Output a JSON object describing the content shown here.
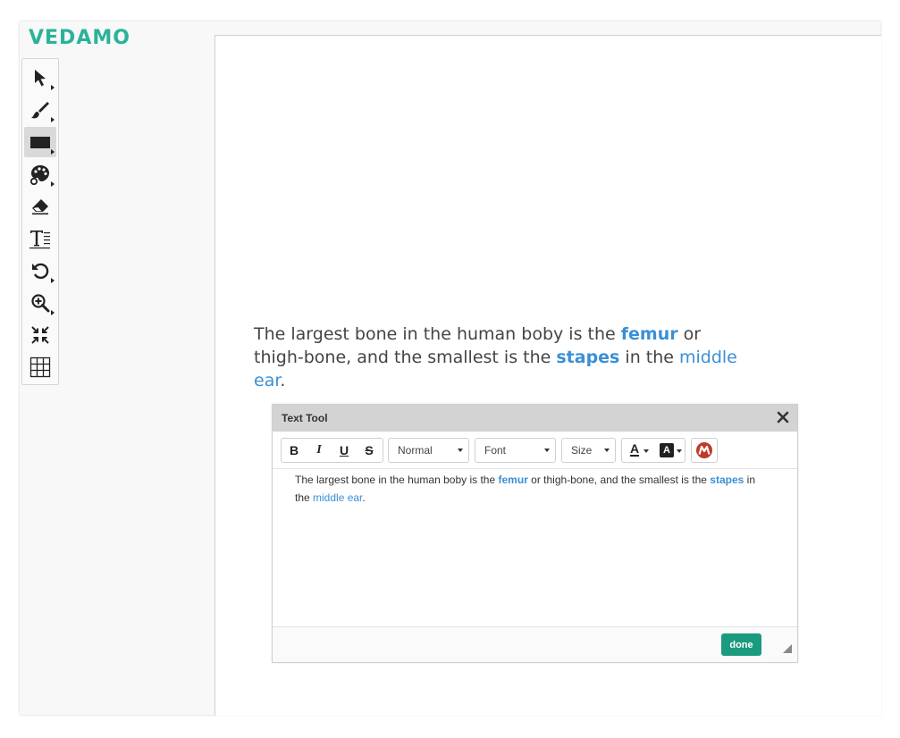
{
  "brand": {
    "logo_text": "VEDAMO",
    "accent": "#2bb29a"
  },
  "toolbar": {
    "tools": [
      {
        "name": "select-tool",
        "icon": "cursor-arrow-icon",
        "has_menu": true
      },
      {
        "name": "brush-tool",
        "icon": "paintbrush-icon",
        "has_menu": true
      },
      {
        "name": "shape-tool",
        "icon": "rectangle-icon",
        "has_menu": true,
        "active": true
      },
      {
        "name": "color-tool",
        "icon": "palette-icon",
        "has_menu": true
      },
      {
        "name": "eraser-tool",
        "icon": "eraser-icon",
        "has_menu": false
      },
      {
        "name": "text-tool",
        "icon": "text-icon",
        "has_menu": false
      },
      {
        "name": "undo-tool",
        "icon": "undo-icon",
        "has_menu": true
      },
      {
        "name": "zoom-tool",
        "icon": "zoom-in-icon",
        "has_menu": true
      },
      {
        "name": "fit-tool",
        "icon": "compress-icon",
        "has_menu": false
      },
      {
        "name": "grid-tool",
        "icon": "grid-icon",
        "has_menu": false
      }
    ]
  },
  "canvas_text": {
    "part1": "The largest bone in the human boby is the ",
    "bold1": "femur",
    "part2": " or thigh-bone, and the smallest is the ",
    "bold2": "stapes",
    "part3": " in the ",
    "link1": "middle ear",
    "part4": "."
  },
  "text_tool": {
    "title": "Text Tool",
    "buttons": {
      "bold": "B",
      "italic": "I",
      "underline": "U",
      "strike": "S"
    },
    "format_select": "Normal",
    "font_select": "Font",
    "size_select": "Size",
    "text_color_label": "A",
    "bg_color_label": "A",
    "editor": {
      "part1": "The largest bone in the human boby is the ",
      "bold1": "femur",
      "part2": " or thigh-bone, and the smallest is the ",
      "bold2": "stapes",
      "part3": " in the ",
      "link1": "middle ear",
      "part4": "."
    },
    "done_label": "done"
  }
}
